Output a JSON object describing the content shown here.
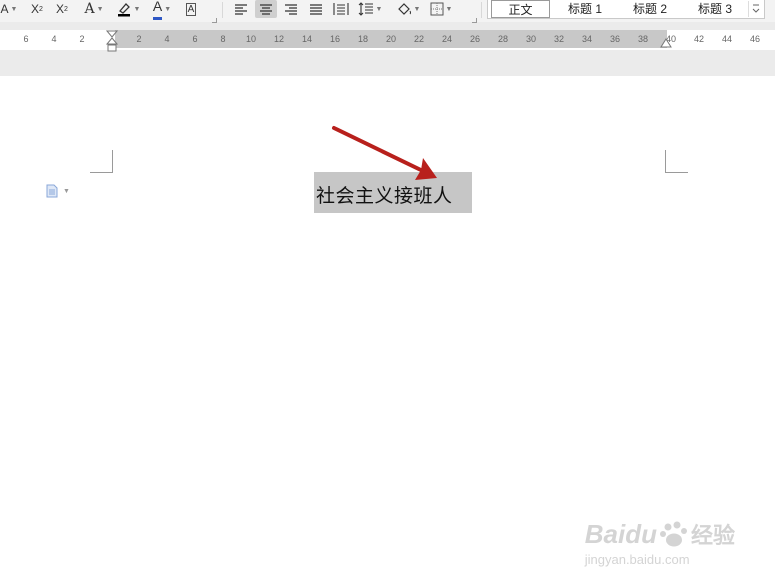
{
  "toolbar": {
    "font_color_icon_letter": "A",
    "superscript": "X",
    "superscript_mark": "2",
    "subscript": "X",
    "subscript_mark": "2",
    "text_effect_letter": "A",
    "font_color_letter": "A",
    "char_border_letter": "A",
    "accent_color": "#2e57c5",
    "highlight_color": "#000000"
  },
  "styles": {
    "items": [
      "正文",
      "标题 1",
      "标题 2",
      "标题 3"
    ],
    "selected": "正文"
  },
  "ruler": {
    "ticks_left": [
      "6",
      "4",
      "2"
    ],
    "ticks_main": [
      "2",
      "4",
      "6",
      "8",
      "10",
      "12",
      "14",
      "16",
      "18",
      "20",
      "22",
      "24",
      "26",
      "28",
      "30",
      "32",
      "34",
      "36",
      "38",
      "40",
      "42",
      "44",
      "46"
    ]
  },
  "document": {
    "title": "社会主义接班人"
  },
  "watermark": {
    "brand": "Baidu",
    "brand_cn": "经验",
    "url": "jingyan.baidu.com"
  },
  "annotation": {
    "arrow_color": "#b8201c"
  }
}
